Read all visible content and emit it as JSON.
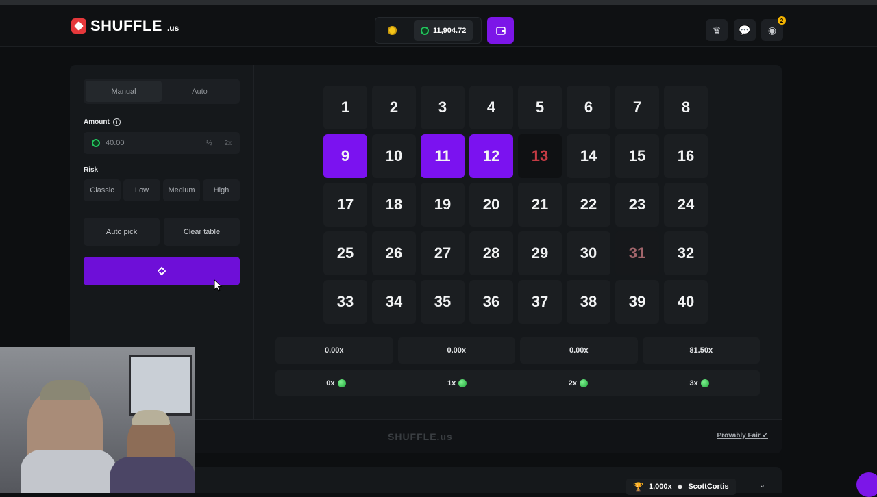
{
  "header": {
    "logo_text": "SHUFFLE",
    "logo_suffix": ".us",
    "balance": "11,904.72",
    "notification_count": "2"
  },
  "game": {
    "mode_tabs": [
      "Manual",
      "Auto"
    ],
    "active_mode": "Manual",
    "amount_label": "Amount",
    "amount_value": "40.00",
    "half_label": "½",
    "double_label": "2x",
    "risk_label": "Risk",
    "risk_options": [
      "Classic",
      "Low",
      "Medium",
      "High"
    ],
    "auto_pick_label": "Auto pick",
    "clear_table_label": "Clear table",
    "bet_icon": "shuffle-logo-icon"
  },
  "tiles": [
    {
      "n": "1",
      "state": "normal"
    },
    {
      "n": "2",
      "state": "normal"
    },
    {
      "n": "3",
      "state": "normal"
    },
    {
      "n": "4",
      "state": "normal"
    },
    {
      "n": "5",
      "state": "normal"
    },
    {
      "n": "6",
      "state": "normal"
    },
    {
      "n": "7",
      "state": "normal"
    },
    {
      "n": "8",
      "state": "normal"
    },
    {
      "n": "9",
      "state": "selected"
    },
    {
      "n": "10",
      "state": "normal"
    },
    {
      "n": "11",
      "state": "selected"
    },
    {
      "n": "12",
      "state": "selected"
    },
    {
      "n": "13",
      "state": "drawn"
    },
    {
      "n": "14",
      "state": "normal"
    },
    {
      "n": "15",
      "state": "normal"
    },
    {
      "n": "16",
      "state": "normal"
    },
    {
      "n": "17",
      "state": "normal"
    },
    {
      "n": "18",
      "state": "normal"
    },
    {
      "n": "19",
      "state": "normal"
    },
    {
      "n": "20",
      "state": "normal"
    },
    {
      "n": "21",
      "state": "normal"
    },
    {
      "n": "22",
      "state": "normal"
    },
    {
      "n": "23",
      "state": "normal"
    },
    {
      "n": "24",
      "state": "normal"
    },
    {
      "n": "25",
      "state": "normal"
    },
    {
      "n": "26",
      "state": "normal"
    },
    {
      "n": "27",
      "state": "normal"
    },
    {
      "n": "28",
      "state": "normal"
    },
    {
      "n": "29",
      "state": "normal"
    },
    {
      "n": "30",
      "state": "normal"
    },
    {
      "n": "31",
      "state": "drawn-dim"
    },
    {
      "n": "32",
      "state": "normal"
    },
    {
      "n": "33",
      "state": "normal"
    },
    {
      "n": "34",
      "state": "normal"
    },
    {
      "n": "35",
      "state": "normal"
    },
    {
      "n": "36",
      "state": "normal"
    },
    {
      "n": "37",
      "state": "normal"
    },
    {
      "n": "38",
      "state": "normal"
    },
    {
      "n": "39",
      "state": "normal"
    },
    {
      "n": "40",
      "state": "normal"
    }
  ],
  "payouts": [
    "0.00x",
    "0.00x",
    "0.00x",
    "81.50x"
  ],
  "hits": [
    "0x",
    "1x",
    "2x",
    "3x"
  ],
  "footer": {
    "logo_text": "SHUFFLE.us",
    "provably_fair": "Provably Fair"
  },
  "bottom_bar": {
    "wager_amount": "1,000x",
    "username": "ScottCortis"
  },
  "colors": {
    "accent": "#7b12f0",
    "drawn": "#c53b44",
    "gem": "#22c55e"
  }
}
